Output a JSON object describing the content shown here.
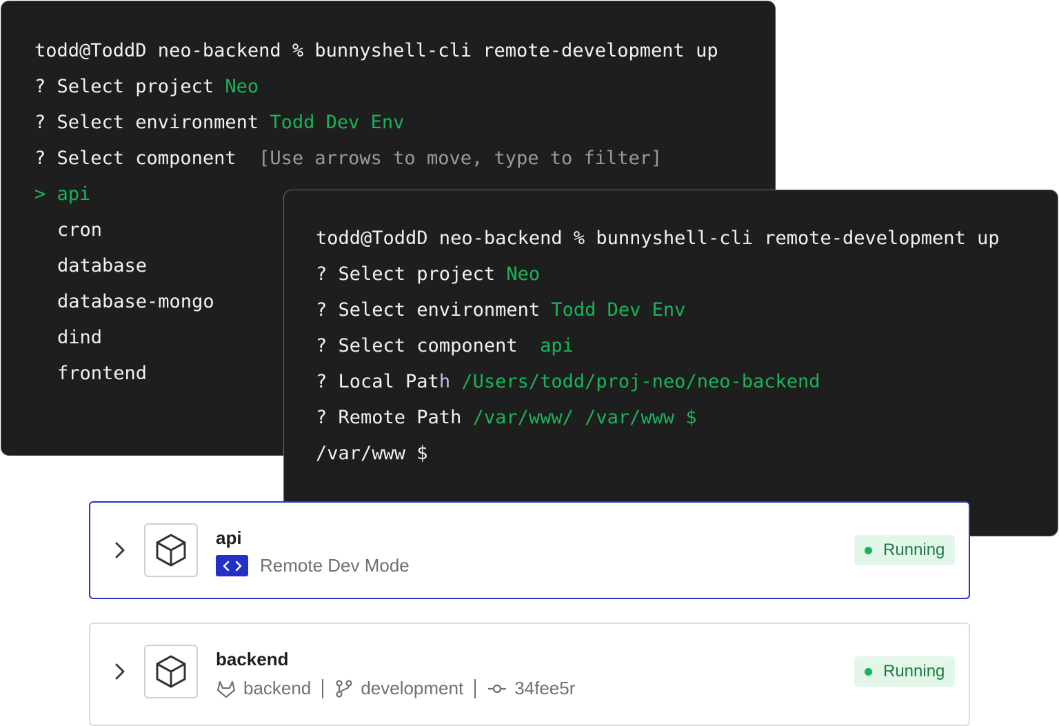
{
  "terminal_back": {
    "prompt": "todd@ToddD neo-backend % bunnyshell-cli remote-development up",
    "q_project_label": "? Select project ",
    "q_project_value": "Neo",
    "q_env_label": "? Select environment ",
    "q_env_value": "Todd Dev Env",
    "q_component_label": "? Select component  ",
    "q_component_hint": "[Use arrows to move, type to filter]",
    "selected_cursor": "> ",
    "selected_item": "api",
    "options": [
      "cron",
      "database",
      "database-mongo",
      "dind",
      "frontend"
    ]
  },
  "terminal_front": {
    "prompt": "todd@ToddD neo-backend % bunnyshell-cli remote-development up",
    "q_project_label": "? Select project ",
    "q_project_value": "Neo",
    "q_env_label": "? Select environment ",
    "q_env_value": "Todd Dev Env",
    "q_component_label": "? Select component  ",
    "q_component_value": "api",
    "q_local_label_a": "? Local Pat",
    "q_local_label_b": "h",
    "q_local_value": " /Users/todd/proj-neo/neo-backend",
    "q_remote_label": "? Remote Path ",
    "q_remote_value": "/var/www/ /var/www $",
    "shell_line": "/var/www $"
  },
  "components": [
    {
      "name": "api",
      "mode_label": "Remote Dev Mode",
      "status": "Running"
    },
    {
      "name": "backend",
      "repo": "backend",
      "branch": "development",
      "commit": "34fee5r",
      "status": "Running"
    }
  ],
  "colors": {
    "terminal_bg": "#1e1e1e",
    "terminal_green": "#19b35a",
    "accent_blue": "#2431c8",
    "status_bg": "#e3f6ea",
    "status_text": "#1e7a45"
  },
  "icons": {
    "expand": "chevron-right-icon",
    "component": "cube-icon",
    "remote_dev": "code-brackets-icon",
    "repo": "gitlab-icon",
    "branch": "git-branch-icon",
    "commit": "git-commit-icon"
  }
}
